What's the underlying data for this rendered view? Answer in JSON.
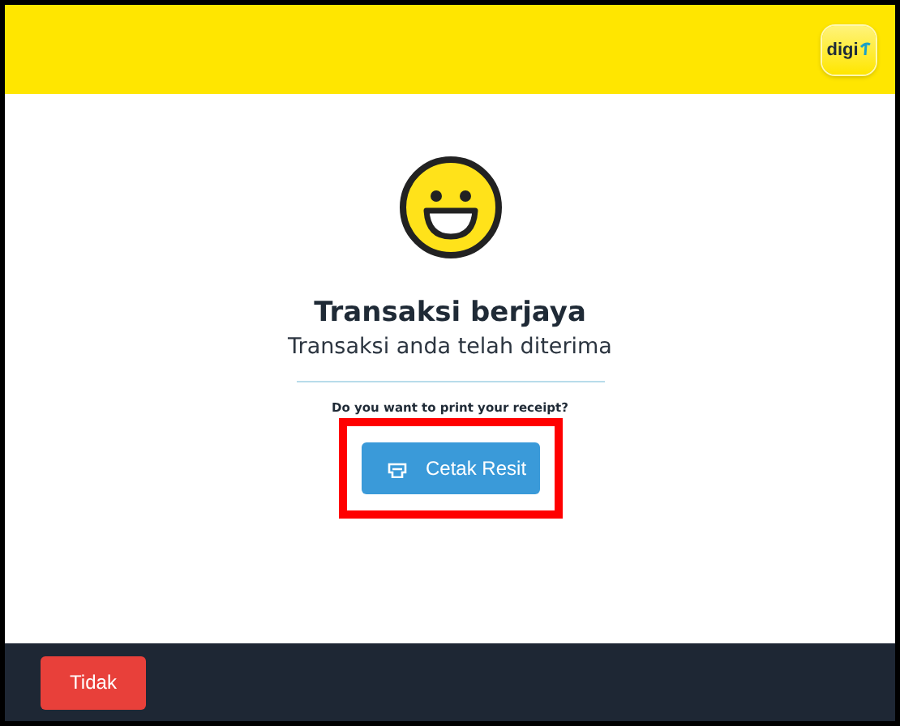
{
  "header": {
    "logo": "digi"
  },
  "result": {
    "title": "Transaksi berjaya",
    "subtitle": "Transaksi anda telah diterima"
  },
  "prompt": "Do you want to print your receipt?",
  "print_button": {
    "label": "Cetak Resit",
    "highlighted": true
  },
  "footer": {
    "buttons": [
      "Tidak"
    ]
  }
}
